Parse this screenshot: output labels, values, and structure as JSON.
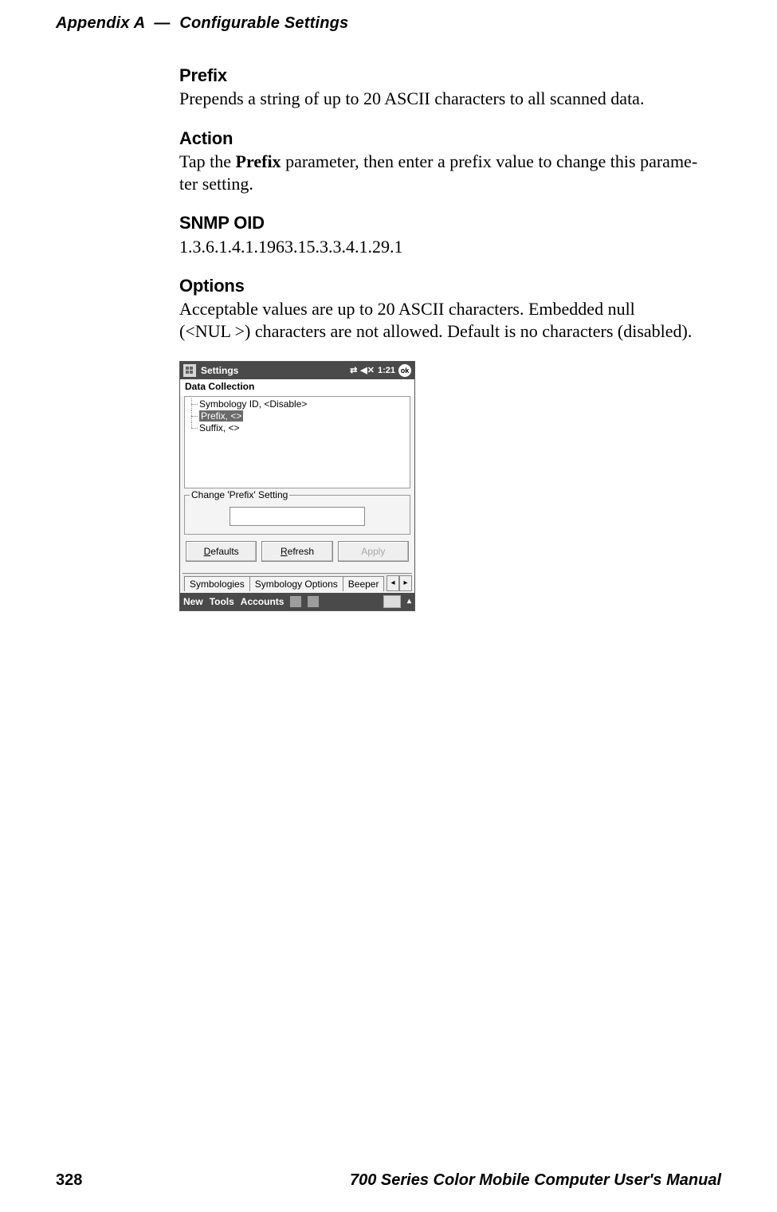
{
  "header": {
    "appendix": "Appendix  A",
    "dash": "—",
    "title": "Configurable Settings"
  },
  "sections": {
    "prefix": {
      "heading": "Prefix",
      "body": "Prepends a string of up to 20 ASCII characters to all scanned data."
    },
    "action": {
      "heading": "Action",
      "body_pre": "Tap the ",
      "body_bold": "Prefix",
      "body_post": " parameter, then enter a prefix value to change this parame-",
      "body_line2": "ter setting."
    },
    "snmp": {
      "heading": "SNMP OID",
      "body": "1.3.6.1.4.1.1963.15.3.3.4.1.29.1"
    },
    "options": {
      "heading": "Options",
      "body_line1": "Acceptable values are up to 20 ASCII characters. Embedded null",
      "body_line2": "(<NUL >) characters are not allowed. Default is no characters (disabled)."
    }
  },
  "device": {
    "titlebar": {
      "title": "Settings",
      "time": "1:21",
      "ok": "ok"
    },
    "app_title": "Data Collection",
    "list": {
      "item1": "Symbology ID, <Disable>",
      "item2_selected": "Prefix, <>",
      "item3": "Suffix, <>"
    },
    "group_legend": "Change 'Prefix' Setting",
    "input_value": "",
    "buttons": {
      "defaults_u": "D",
      "defaults_rest": "efaults",
      "refresh_u": "R",
      "refresh_rest": "efresh",
      "apply": "Apply"
    },
    "tabs": {
      "t1": "Symbologies",
      "t2": "Symbology Options",
      "t3": "Beeper"
    },
    "bottombar": {
      "b1": "New",
      "b2": "Tools",
      "b3": "Accounts"
    }
  },
  "footer": {
    "page": "328",
    "manual": "700 Series Color Mobile Computer User's Manual"
  }
}
